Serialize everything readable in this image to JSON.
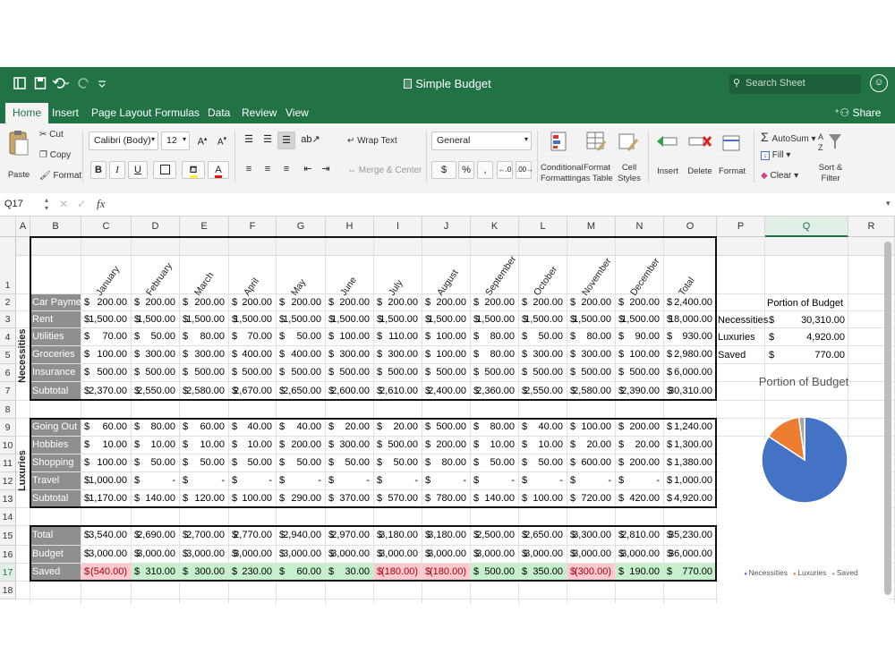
{
  "window": {
    "title": "Simple Budget",
    "search_placeholder": "Search Sheet"
  },
  "tabs": [
    "Home",
    "Insert",
    "Page Layout",
    "Formulas",
    "Data",
    "Review",
    "View"
  ],
  "share_label": "Share",
  "ribbon": {
    "paste": "Paste",
    "cut": "Cut",
    "copy": "Copy",
    "format_painter": "Format",
    "font_name": "Calibri (Body)",
    "font_size": "12",
    "bold": "B",
    "italic": "I",
    "underline": "U",
    "wrap_text": "Wrap Text",
    "merge_center": "Merge & Center",
    "number_format": "General",
    "currency": "$",
    "percent": "%",
    "comma": ",",
    "conditional_formatting": [
      "Conditional",
      "Formatting"
    ],
    "format_as_table": [
      "Format",
      "as Table"
    ],
    "cell_styles": [
      "Cell",
      "Styles"
    ],
    "insert": "Insert",
    "delete": "Delete",
    "format": "Format",
    "autosum": "AutoSum",
    "fill": "Fill",
    "clear": "Clear",
    "sort_filter": [
      "Sort &",
      "Filter"
    ]
  },
  "formula_bar": {
    "name_box": "Q17",
    "fx": "fx"
  },
  "columns": [
    "A",
    "B",
    "C",
    "D",
    "E",
    "F",
    "G",
    "H",
    "I",
    "J",
    "K",
    "L",
    "M",
    "N",
    "O",
    "P",
    "Q",
    "R"
  ],
  "rows": [
    "1",
    "2",
    "3",
    "4",
    "5",
    "6",
    "7",
    "8",
    "9",
    "10",
    "11",
    "12",
    "13",
    "14",
    "15",
    "16",
    "17",
    "18"
  ],
  "months": [
    "January",
    "February",
    "March",
    "April",
    "May",
    "June",
    "July",
    "August",
    "September",
    "October",
    "November",
    "December",
    "Total"
  ],
  "sections": {
    "necessities": "Necessities",
    "luxuries": "Luxuries"
  },
  "currency_symbol": "$",
  "table": [
    {
      "row": 2,
      "label": "Car Payment",
      "values": [
        "200.00",
        "200.00",
        "200.00",
        "200.00",
        "200.00",
        "200.00",
        "200.00",
        "200.00",
        "200.00",
        "200.00",
        "200.00",
        "200.00",
        "2,400.00"
      ]
    },
    {
      "row": 3,
      "label": "Rent",
      "values": [
        "1,500.00",
        "1,500.00",
        "1,500.00",
        "1,500.00",
        "1,500.00",
        "1,500.00",
        "1,500.00",
        "1,500.00",
        "1,500.00",
        "1,500.00",
        "1,500.00",
        "1,500.00",
        "18,000.00"
      ]
    },
    {
      "row": 4,
      "label": "Utilities",
      "values": [
        "70.00",
        "50.00",
        "80.00",
        "70.00",
        "50.00",
        "100.00",
        "110.00",
        "100.00",
        "80.00",
        "50.00",
        "80.00",
        "90.00",
        "930.00"
      ]
    },
    {
      "row": 5,
      "label": "Groceries",
      "values": [
        "100.00",
        "300.00",
        "300.00",
        "400.00",
        "400.00",
        "300.00",
        "300.00",
        "100.00",
        "80.00",
        "300.00",
        "300.00",
        "100.00",
        "2,980.00"
      ]
    },
    {
      "row": 6,
      "label": "Insurance",
      "values": [
        "500.00",
        "500.00",
        "500.00",
        "500.00",
        "500.00",
        "500.00",
        "500.00",
        "500.00",
        "500.00",
        "500.00",
        "500.00",
        "500.00",
        "6,000.00"
      ]
    },
    {
      "row": 7,
      "label": "Subtotal",
      "values": [
        "2,370.00",
        "2,550.00",
        "2,580.00",
        "2,670.00",
        "2,650.00",
        "2,600.00",
        "2,610.00",
        "2,400.00",
        "2,360.00",
        "2,550.00",
        "2,580.00",
        "2,390.00",
        "30,310.00"
      ]
    },
    {
      "row": 9,
      "label": "Going Out",
      "values": [
        "60.00",
        "80.00",
        "60.00",
        "40.00",
        "40.00",
        "20.00",
        "20.00",
        "500.00",
        "80.00",
        "40.00",
        "100.00",
        "200.00",
        "1,240.00"
      ]
    },
    {
      "row": 10,
      "label": "Hobbies",
      "values": [
        "10.00",
        "10.00",
        "10.00",
        "10.00",
        "200.00",
        "300.00",
        "500.00",
        "200.00",
        "10.00",
        "10.00",
        "20.00",
        "20.00",
        "1,300.00"
      ]
    },
    {
      "row": 11,
      "label": "Shopping",
      "values": [
        "100.00",
        "50.00",
        "50.00",
        "50.00",
        "50.00",
        "50.00",
        "50.00",
        "80.00",
        "50.00",
        "50.00",
        "600.00",
        "200.00",
        "1,380.00"
      ]
    },
    {
      "row": 12,
      "label": "Travel",
      "values": [
        "1,000.00",
        "-",
        "-",
        "-",
        "-",
        "-",
        "-",
        "-",
        "-",
        "-",
        "-",
        "-",
        "1,000.00"
      ]
    },
    {
      "row": 13,
      "label": "Subtotal",
      "values": [
        "1,170.00",
        "140.00",
        "120.00",
        "100.00",
        "290.00",
        "370.00",
        "570.00",
        "780.00",
        "140.00",
        "100.00",
        "720.00",
        "420.00",
        "4,920.00"
      ]
    },
    {
      "row": 15,
      "label": "Total",
      "values": [
        "3,540.00",
        "2,690.00",
        "2,700.00",
        "2,770.00",
        "2,940.00",
        "2,970.00",
        "3,180.00",
        "3,180.00",
        "2,500.00",
        "2,650.00",
        "3,300.00",
        "2,810.00",
        "35,230.00"
      ]
    },
    {
      "row": 16,
      "label": "Budget",
      "values": [
        "3,000.00",
        "3,000.00",
        "3,000.00",
        "3,000.00",
        "3,000.00",
        "3,000.00",
        "3,000.00",
        "3,000.00",
        "3,000.00",
        "3,000.00",
        "3,000.00",
        "3,000.00",
        "36,000.00"
      ]
    },
    {
      "row": 17,
      "label": "Saved",
      "values": [
        "(540.00)",
        "310.00",
        "300.00",
        "230.00",
        "60.00",
        "30.00",
        "(180.00)",
        "(180.00)",
        "500.00",
        "350.00",
        "(300.00)",
        "190.00",
        "770.00"
      ]
    }
  ],
  "portion": {
    "title": "Portion of Budget",
    "rows": [
      {
        "label": "Necessities",
        "value": "30,310.00"
      },
      {
        "label": "Luxuries",
        "value": "4,920.00"
      },
      {
        "label": "Saved",
        "value": "770.00"
      }
    ]
  },
  "chart_data": {
    "type": "pie",
    "title": "Portion of Budget",
    "categories": [
      "Necessities",
      "Luxuries",
      "Saved"
    ],
    "values": [
      30310,
      4920,
      770
    ],
    "colors": [
      "#4472c4",
      "#ed7d31",
      "#a5a5a5"
    ],
    "legend": "bottom"
  }
}
